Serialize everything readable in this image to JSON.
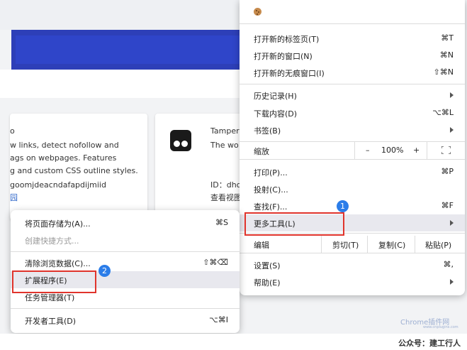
{
  "page": {
    "card1": {
      "lines": [
        "o",
        "w links, detect nofollow and",
        "ags on webpages. Features",
        "g and custom CSS outline styles."
      ],
      "id_text": "goomjdeacndafapdijmiid",
      "link_text": "园"
    },
    "card2": {
      "title": "Tamper",
      "desc": "The wo",
      "id_label": "ID：dhc",
      "view_label": "查看视图"
    }
  },
  "main_menu": {
    "new_tab": {
      "label": "打开新的标签页(T)",
      "shortcut": "⌘T"
    },
    "new_window": {
      "label": "打开新的窗口(N)",
      "shortcut": "⌘N"
    },
    "incognito": {
      "label": "打开新的无痕窗口(I)",
      "shortcut": "⇧⌘N"
    },
    "history": {
      "label": "历史记录(H)"
    },
    "downloads": {
      "label": "下载内容(D)",
      "shortcut": "⌥⌘L"
    },
    "bookmarks": {
      "label": "书签(B)"
    },
    "zoom": {
      "label": "缩放",
      "minus": "–",
      "value": "100%",
      "plus": "+"
    },
    "print": {
      "label": "打印(P)...",
      "shortcut": "⌘P"
    },
    "cast": {
      "label": "投射(C)..."
    },
    "find": {
      "label": "查找(F)...",
      "shortcut": "⌘F"
    },
    "more_tools": {
      "label": "更多工具(L)"
    },
    "edit": {
      "label": "编辑",
      "cut": "剪切(T)",
      "copy": "复制(C)",
      "paste": "粘贴(P)"
    },
    "settings": {
      "label": "设置(S)",
      "shortcut": "⌘,"
    },
    "help": {
      "label": "帮助(E)"
    }
  },
  "sub_menu": {
    "save_page": {
      "label": "将页面存储为(A)...",
      "shortcut": "⌘S"
    },
    "create_shortcut": {
      "label": "创建快捷方式..."
    },
    "clear_data": {
      "label": "清除浏览数据(C)...",
      "shortcut": "⇧⌘⌫"
    },
    "extensions": {
      "label": "扩展程序(E)"
    },
    "task_manager": {
      "label": "任务管理器(T)"
    },
    "dev_tools": {
      "label": "开发者工具(D)",
      "shortcut": "⌥⌘I"
    }
  },
  "annotations": {
    "badge1": "1",
    "badge2": "2"
  },
  "watermark": {
    "logo": "Chrome插件网",
    "url": "www.cnplugins.com"
  },
  "footer": {
    "text": "公众号：建工行人"
  },
  "colors": {
    "highlight_box": "#e0342c",
    "badge": "#2b7de9",
    "banner": "#2d3fb8"
  }
}
